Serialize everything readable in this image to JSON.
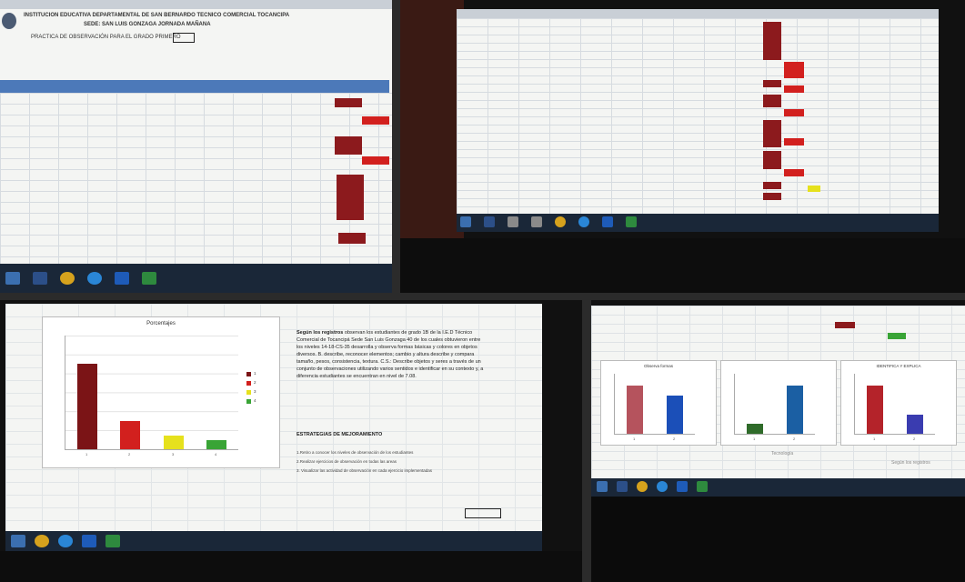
{
  "panel1": {
    "title_line1": "INSTITUCION EDUCATIVA DEPARTAMENTAL DE SAN BERNARDO TECNICO COMERCIAL TOCANCIPA",
    "title_line2": "SEDE: SAN LUIS GONZAGA JORNADA MAÑANA",
    "title_line3": "PRACTICA DE OBSERVACIÓN PARA EL GRADO PRIMERO"
  },
  "panel3": {
    "chart_title": "Porcentajes",
    "heading_bold": "Según los registros",
    "paragraph": "observan los estudiantes de grado 1B de la I.E.D Técnico Comercial de Tocancipá Sede San Luis Gonzaga 40 de los cuales obtuvieron entre los niveles 14-18-CS-35 desarrolla y observa formas básicas y colores en objetos diversos. B. describe, reconocer elementos; cambio y altura describe y compara tamaño, pesos, consistencia, textura. C.S.: Describe objetos y seres a través de un conjunto de observaciones utilizando varios sentidos e identificar en su contexto y, a diferencia estudiantes se encuentran en nivel de 7.08.",
    "strategy_heading": "ESTRATEGIAS DE MEJORAMIENTO",
    "strategies": [
      "1.Retiro a conocer los niveles de observación de los estudiantes",
      "2.Realizar ejercicios de observación en todas las areas",
      "3. Visualizar las actividad de observación en cada ejercicio implementadas"
    ]
  },
  "panel4": {
    "chart1_title": "Observa formas",
    "chart3_title": "IDENTIFICA Y EXPLICA",
    "axis_label": "Tecnología",
    "note": "Según los registros"
  },
  "colors": {
    "dark_red": "#7b1416",
    "bright_red": "#d2201e",
    "yellow": "#e6e11d",
    "green": "#39a436",
    "blue": "#1b4fb8",
    "header_blue": "#4c79b9"
  },
  "chart_data": [
    {
      "type": "bar",
      "title": "Porcentajes",
      "categories": [
        "1",
        "2",
        "3",
        "4"
      ],
      "values": [
        45,
        15,
        7,
        5
      ],
      "colors": [
        "#7b1416",
        "#d2201e",
        "#e6e11d",
        "#39a436"
      ],
      "ylim": [
        0,
        60
      ],
      "legend": "right"
    },
    {
      "type": "bar",
      "title": "Observa formas",
      "categories": [
        "1",
        "2"
      ],
      "values": [
        40,
        32
      ],
      "colors": [
        "#b5535d",
        "#1b4fb8"
      ],
      "ylim": [
        0,
        50
      ],
      "legend": "right"
    },
    {
      "type": "bar",
      "title": "",
      "categories": [
        "1",
        "2"
      ],
      "values": [
        8,
        40
      ],
      "colors": [
        "#2f6b2a",
        "#1b5fa3"
      ],
      "ylim": [
        0,
        50
      ],
      "legend": "right"
    },
    {
      "type": "bar",
      "title": "IDENTIFICA Y EXPLICA",
      "categories": [
        "1",
        "2"
      ],
      "values": [
        40,
        16
      ],
      "colors": [
        "#b4232a",
        "#3a3cb0"
      ],
      "ylim": [
        0,
        50
      ],
      "legend": "right"
    }
  ]
}
